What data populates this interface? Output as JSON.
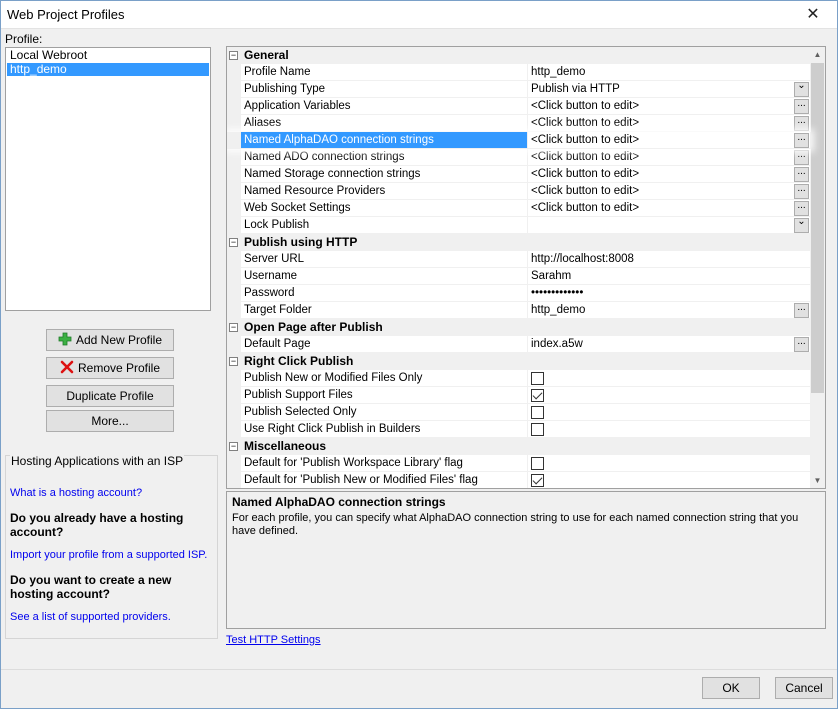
{
  "window": {
    "title": "Web Project Profiles",
    "close_glyph": "✕"
  },
  "profiles": {
    "label": "Profile:",
    "items": [
      "Local Webroot",
      "http_demo"
    ],
    "selected": "http_demo"
  },
  "buttons": {
    "add": "Add New Profile",
    "remove": "Remove Profile",
    "duplicate": "Duplicate Profile",
    "more": "More..."
  },
  "hosting": {
    "header": "Hosting Applications with an ISP",
    "link1": "What is a hosting account?",
    "q1": "Do you already have a hosting account?",
    "link2": "Import your profile from a supported ISP.",
    "q2": "Do you want to create a new hosting account?",
    "link3": "See a list of supported providers."
  },
  "grid": {
    "rows": [
      {
        "kind": "cat",
        "label": "General"
      },
      {
        "kind": "prop",
        "name": "Profile Name",
        "value": "http_demo"
      },
      {
        "kind": "prop",
        "name": "Publishing Type",
        "value": "Publish via HTTP",
        "editor": "dropdown"
      },
      {
        "kind": "prop",
        "name": "Application Variables",
        "value": "<Click button to edit>",
        "editor": "ellipsis"
      },
      {
        "kind": "prop",
        "name": "Aliases",
        "value": "<Click button to edit>",
        "editor": "ellipsis"
      },
      {
        "kind": "prop",
        "name": "Named AlphaDAO connection strings",
        "value": "<Click button to edit>",
        "editor": "ellipsis",
        "selected": true
      },
      {
        "kind": "prop",
        "name": "Named ADO connection strings",
        "value": "<Click button to edit>",
        "editor": "ellipsis"
      },
      {
        "kind": "prop",
        "name": "Named Storage connection strings",
        "value": "<Click button to edit>",
        "editor": "ellipsis"
      },
      {
        "kind": "prop",
        "name": "Named Resource Providers",
        "value": "<Click button to edit>",
        "editor": "ellipsis"
      },
      {
        "kind": "prop",
        "name": "Web Socket Settings",
        "value": "<Click button to edit>",
        "editor": "ellipsis"
      },
      {
        "kind": "prop",
        "name": "Lock Publish",
        "value": "",
        "editor": "dropdown"
      },
      {
        "kind": "cat",
        "label": "Publish using HTTP"
      },
      {
        "kind": "prop",
        "name": "Server URL",
        "value": "http://localhost:8008"
      },
      {
        "kind": "prop",
        "name": "Username",
        "value": "Sarahm"
      },
      {
        "kind": "prop",
        "name": "Password",
        "value": "•••••••••••••"
      },
      {
        "kind": "prop",
        "name": "Target Folder",
        "value": "http_demo",
        "editor": "ellipsis"
      },
      {
        "kind": "cat",
        "label": "Open Page after Publish"
      },
      {
        "kind": "prop",
        "name": "Default Page",
        "value": "index.a5w",
        "editor": "ellipsis"
      },
      {
        "kind": "cat",
        "label": "Right Click Publish"
      },
      {
        "kind": "prop",
        "name": "Publish New or Modified Files Only",
        "checkbox": true,
        "checked": false
      },
      {
        "kind": "prop",
        "name": "Publish Support Files",
        "checkbox": true,
        "checked": true
      },
      {
        "kind": "prop",
        "name": "Publish Selected Only",
        "checkbox": true,
        "checked": false
      },
      {
        "kind": "prop",
        "name": "Use Right Click Publish in Builders",
        "checkbox": true,
        "checked": false
      },
      {
        "kind": "cat",
        "label": "Miscellaneous"
      },
      {
        "kind": "prop",
        "name": "Default for 'Publish Workspace Library' flag",
        "checkbox": true,
        "checked": false
      },
      {
        "kind": "prop",
        "name": "Default for 'Publish New or Modified Files' flag",
        "checkbox": true,
        "checked": true
      }
    ]
  },
  "description": {
    "title": "Named AlphaDAO connection strings",
    "text": "For each profile, you can specify what AlphaDAO connection string to use for each named connection string that you have defined."
  },
  "test_link": "Test HTTP Settings",
  "footer": {
    "ok": "OK",
    "cancel": "Cancel"
  },
  "colors": {
    "selection": "#3399ff",
    "link": "#0000ee"
  }
}
